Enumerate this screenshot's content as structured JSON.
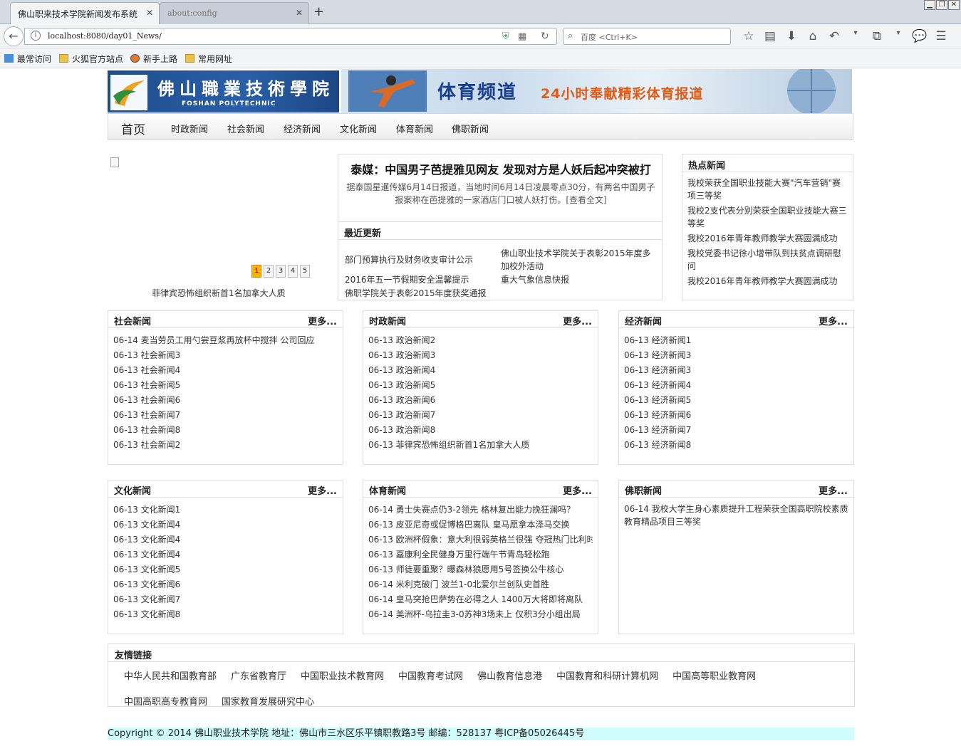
{
  "browser": {
    "tabs": [
      {
        "title": "佛山职来技术学院新闻发布系统",
        "active": true
      },
      {
        "title": "about:config",
        "active": false
      }
    ],
    "new_tab": "+",
    "url": "localhost:8080/day01_News/",
    "search_placeholder": "百度 <Ctrl+K>",
    "bookmarks": [
      "最常访问",
      "火狐官方站点",
      "新手上路",
      "常用网址"
    ]
  },
  "site": {
    "logo_title": "佛山職業技術學院",
    "logo_subtitle": "FOSHAN POLYTECHNIC",
    "banner_title": "体育频道",
    "banner_slogan": "24小时奉献精彩体育报道"
  },
  "nav": {
    "home": "首页",
    "items": [
      "时政新闻",
      "社会新闻",
      "经济新闻",
      "文化新闻",
      "体育新闻",
      "佛职新闻"
    ]
  },
  "carousel": {
    "pages": [
      "1",
      "2",
      "3",
      "4",
      "5"
    ],
    "active_page": "1",
    "caption": "菲律宾恐怖组织新首1名加拿大人质"
  },
  "headline": {
    "title": "泰媒：中国男子芭提雅见网友 发现对方是人妖后起冲突被打",
    "summary": "据泰国星暹传媒6月14日报道，当地时间6月14日凌晨零点30分，有两名中国男子报案称在芭提雅的一家酒店门口被人妖打伤。[查看全文]"
  },
  "recent": {
    "heading": "最近更新",
    "items": [
      "部门预算执行及财务收支审计公示",
      "佛山职业技术学院关于表彰2015年度多加校外活动",
      "2016年五一节假期安全温馨提示",
      "重大气象信息快报",
      "佛职学院关于表彰2015年度获奖通报"
    ]
  },
  "hot": {
    "heading": "热点新闻",
    "items": [
      "我校荣获全国职业技能大赛\"汽车营销\"赛项三等奖",
      "我校2支代表分别荣获全国职业技能大赛三等奖",
      "我校2016年青年教师教学大赛圆满成功",
      "我校党委书记徐小增带队到扶贫点调研慰问",
      "我校2016年青年教师教学大赛圆满成功"
    ]
  },
  "more_label": "更多...",
  "categories": [
    {
      "title": "社会新闻",
      "items": [
        "06-14 麦当劳员工用勺尝豆浆再放杯中搅拌 公司回应",
        "06-13 社会新闻3",
        "06-13 社会新闻4",
        "06-13 社会新闻5",
        "06-13 社会新闻6",
        "06-13 社会新闻7",
        "06-13 社会新闻8",
        "06-13 社会新闻2"
      ]
    },
    {
      "title": "时政新闻",
      "items": [
        "06-13 政治新闻2",
        "06-13 政治新闻3",
        "06-13 政治新闻4",
        "06-13 政治新闻5",
        "06-13 政治新闻6",
        "06-13 政治新闻7",
        "06-13 政治新闻8",
        "06-13 菲律宾恐怖组织新首1名加拿大人质"
      ]
    },
    {
      "title": "经济新闻",
      "items": [
        "06-13 经济新闻1",
        "06-13 经济新闻3",
        "06-13 经济新闻3",
        "06-13 经济新闻4",
        "06-13 经济新闻5",
        "06-13 经济新闻6",
        "06-13 经济新闻7",
        "06-13 经济新闻8"
      ]
    },
    {
      "title": "文化新闻",
      "items": [
        "06-13 文化新闻1",
        "06-13 文化新闻4",
        "06-13 文化新闻4",
        "06-13 文化新闻4",
        "06-13 文化新闻5",
        "06-13 文化新闻6",
        "06-13 文化新闻7",
        "06-13 文化新闻8"
      ]
    },
    {
      "title": "体育新闻",
      "items": [
        "06-14 勇士失赛点仍3-2领先 格林复出能力挽狂澜吗？",
        "06-13 皮亚尼奇或促博格巴离队 皇马愿拿本泽马交换",
        "06-13 欧洲杯假象：意大利很弱英格兰很强 夺冠热门比利时",
        "06-13 嘉康利全民健身万里行端午节青岛轻松跑",
        "06-13 师徒要重聚？曝森林狼愿用5号签换公牛核心",
        "06-14 米利克破门 波兰1-0北爱尔兰创队史首胜",
        "06-14 皇马突抢巴萨势在必得之人 1400万大将即将离队",
        "06-14 美洲杯-乌拉圭3-0苏神3场未上 仅积3分小组出局"
      ]
    },
    {
      "title": "佛职新闻",
      "items": [
        "06-14 我校大学生身心素质提升工程荣获全国高职院校素质教育精品项目三等奖"
      ]
    }
  ],
  "links": {
    "heading": "友情链接",
    "items": [
      "中华人民共和国教育部",
      "广东省教育厅",
      "中国职业技术教育网",
      "中国教育考试网",
      "佛山教育信息港",
      "中国教育和科研计算机网",
      "中国高等职业教育网",
      "中国高职高专教育网",
      "国家教育发展研究中心"
    ]
  },
  "footer": "Copyright © 2014 佛山职业技术学院 地址：佛山市三水区乐平镇职教路3号 邮编：528137 粤ICP备05026445号",
  "colors": {
    "pager_active": "#f5b700",
    "footer_bg": "#cffcfc",
    "logo_bg": "#1e4c8d"
  }
}
